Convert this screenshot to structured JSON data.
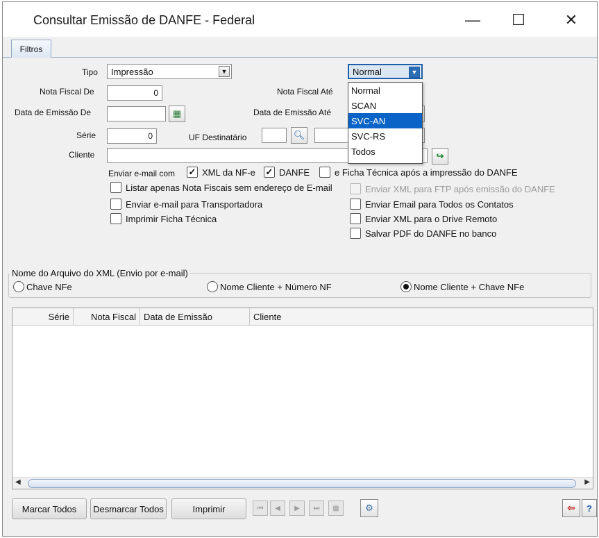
{
  "window": {
    "title": "Consultar Emissão de DANFE - Federal",
    "minimize": "—",
    "maximize": "☐",
    "close": "✕"
  },
  "tabs": [
    {
      "label": "Filtros"
    }
  ],
  "form": {
    "tipo_label": "Tipo",
    "tipo_value": "Impressão",
    "emission_mode_value": "Normal",
    "nf_de_label": "Nota Fiscal De",
    "nf_de_value": "0",
    "nf_ate_label": "Nota Fiscal Até",
    "data_de_label": "Data de Emissão De",
    "data_ate_label": "Data de Emissão Até",
    "serie_label": "Série",
    "serie_value": "0",
    "uf_label": "UF Destinatário",
    "cliente_label": "Cliente",
    "enviar_email_label": "Enviar e-mail com"
  },
  "dropdown": {
    "options": [
      "Normal",
      "SCAN",
      "SVC-AN",
      "SVC-RS",
      "Todos"
    ],
    "selected_index": 2
  },
  "checkboxes": {
    "xml_nfe": {
      "label": "XML da NF-e",
      "checked": true
    },
    "danfe": {
      "label": "DANFE",
      "checked": true
    },
    "ficha_tecnica_apos": {
      "label": "e Ficha Técnica após a impressão do DANFE",
      "checked": false
    },
    "listar_sem_email": {
      "label": "Listar apenas Nota Fiscais sem endereço de E-mail",
      "checked": false
    },
    "email_transportadora": {
      "label": "Enviar e-mail para Transportadora",
      "checked": false
    },
    "imprimir_ficha": {
      "label": "Imprimir Ficha Técnica",
      "checked": false
    },
    "xml_ftp": {
      "label": "Enviar XML para FTP após emissão do DANFE",
      "checked": false,
      "disabled": true
    },
    "email_todos_contatos": {
      "label": "Enviar Email para Todos os Contatos",
      "checked": false
    },
    "xml_drive": {
      "label": "Enviar XML para o Drive Remoto",
      "checked": false
    },
    "pdf_banco": {
      "label": "Salvar PDF do DANFE no banco",
      "checked": false
    }
  },
  "xml_group": {
    "title": "Nome do Arquivo do XML (Envio por e-mail)",
    "options": [
      "Chave NFe",
      "Nome Cliente + Número NF",
      "Nome Cliente + Chave NFe"
    ],
    "selected_index": 2
  },
  "grid": {
    "columns": [
      "Série",
      "Nota Fiscal",
      "Data de Emissão",
      "Cliente"
    ],
    "rows": []
  },
  "buttons": {
    "marcar_todos": "Marcar Todos",
    "desmarcar_todos": "Desmarcar Todos",
    "imprimir": "Imprimir"
  },
  "icons": {
    "calendar": "calendar-icon",
    "search": "search-icon",
    "go": "green-arrow-icon",
    "config": "settings-icon",
    "exit": "exit-icon",
    "help": "help-icon"
  }
}
